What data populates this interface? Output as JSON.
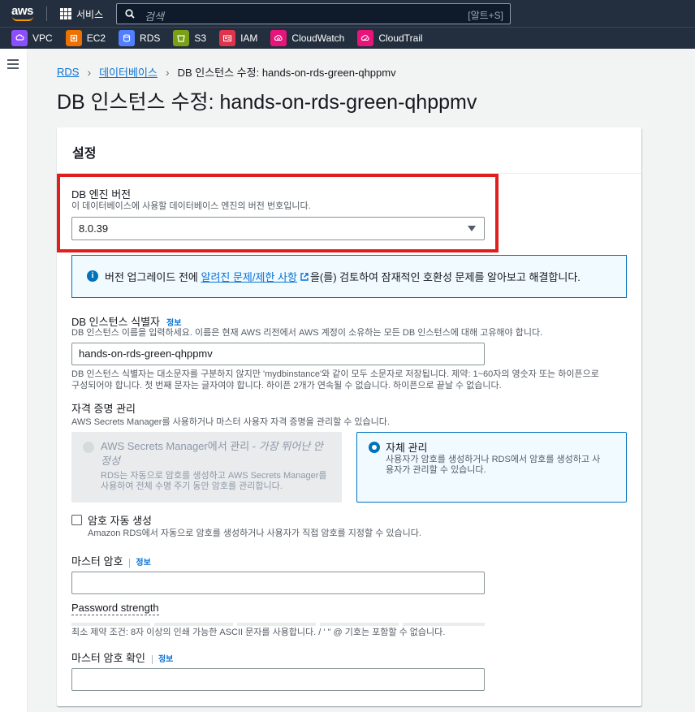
{
  "topnav": {
    "logo": "aws",
    "services_label": "서비스",
    "search_placeholder": "검색",
    "search_shortcut": "[알트+S]"
  },
  "favorites": [
    {
      "label": "VPC",
      "icon": "vpc-icon",
      "color": "#8c4fff"
    },
    {
      "label": "EC2",
      "icon": "ec2-icon",
      "color": "#ed7100"
    },
    {
      "label": "RDS",
      "icon": "rds-icon",
      "color": "#527fff"
    },
    {
      "label": "S3",
      "icon": "s3-icon",
      "color": "#7aa116"
    },
    {
      "label": "IAM",
      "icon": "iam-icon",
      "color": "#dd344c"
    },
    {
      "label": "CloudWatch",
      "icon": "cloudwatch-icon",
      "color": "#e7157b"
    },
    {
      "label": "CloudTrail",
      "icon": "cloudtrail-icon",
      "color": "#e7157b"
    }
  ],
  "breadcrumb": {
    "items": [
      "RDS",
      "데이터베이스"
    ],
    "current": "DB 인스턴스 수정: hands-on-rds-green-qhppmv"
  },
  "page_title": "DB 인스턴스 수정: hands-on-rds-green-qhppmv",
  "panel": {
    "title": "설정",
    "engine": {
      "label": "DB 엔진 버전",
      "description": "이 데이터베이스에 사용할 데이터베이스 엔진의 버전 번호입니다.",
      "value": "8.0.39"
    },
    "alert": {
      "prefix": "버전 업그레이드 전에 ",
      "link": "알려진 문제/제한 사항",
      "suffix": "을(를) 검토하여 잠재적인 호환성 문제를 알아보고 해결합니다."
    },
    "identifier": {
      "label": "DB 인스턴스 식별자",
      "info": "정보",
      "description": "DB 인스턴스 이름을 입력하세요. 이름은 현재 AWS 리전에서 AWS 계정이 소유하는 모든 DB 인스턴스에 대해 고유해야 합니다.",
      "value": "hands-on-rds-green-qhppmv",
      "constraint_line1": "DB 인스턴스 식별자는 대소문자를 구분하지 않지만 'mydbinstance'와 같이 모두 소문자로 저장됩니다. 제약: 1~60자의 영숫자 또는 하이픈으로",
      "constraint_line2": "구성되어야 합니다. 첫 번째 문자는 글자여야 합니다. 하이픈 2개가 연속될 수 없습니다. 하이픈으로 끝날 수 없습니다."
    },
    "credentials": {
      "label": "자격 증명 관리",
      "description": "AWS Secrets Manager를 사용하거나 마스터 사용자 자격 증명을 관리할 수 있습니다.",
      "option1_title_line1": "AWS Secrets Manager에서 관리 - ",
      "option1_title_italic": "가장 뛰어난 안",
      "option1_title_line2": "정성",
      "option1_desc_line1": "RDS는 자동으로 암호를 생성하고 AWS Secrets Manager를",
      "option1_desc_line2": "사용하여 전체 수명 주기 동안 암호를 관리합니다.",
      "option2_title": "자체 관리",
      "option2_desc_line1": "사용자가 암호를 생성하거나 RDS에서 암호를 생성하고 사",
      "option2_desc_line2": "용자가 관리할 수 있습니다."
    },
    "auto_password": {
      "label": "암호 자동 생성",
      "description": "Amazon RDS에서 자동으로 암호를 생성하거나 사용자가 직접 암호를 지정할 수 있습니다."
    },
    "master_password": {
      "label": "마스터 암호",
      "info": "정보",
      "value": "",
      "strength_label": "Password strength",
      "constraint": "최소 제약 조건: 8자 이상의 인쇄 가능한 ASCII 문자를 사용합니다. / ' \" @ 기호는 포함할 수 없습니다."
    },
    "confirm_password": {
      "label": "마스터 암호 확인",
      "info": "정보",
      "value": ""
    }
  }
}
